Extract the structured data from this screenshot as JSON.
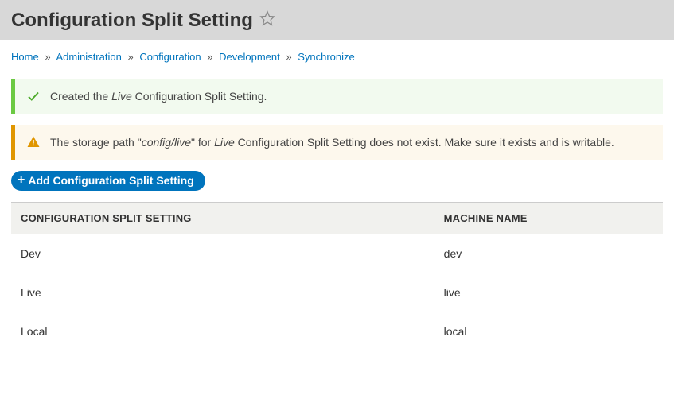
{
  "header": {
    "title": "Configuration Split Setting"
  },
  "breadcrumb": {
    "items": [
      {
        "label": "Home"
      },
      {
        "label": "Administration"
      },
      {
        "label": "Configuration"
      },
      {
        "label": "Development"
      },
      {
        "label": "Synchronize"
      }
    ],
    "separator": "»"
  },
  "messages": {
    "success": {
      "prefix": "Created the ",
      "em": "Live",
      "suffix": " Configuration Split Setting."
    },
    "warning": {
      "prefix": "The storage path \"",
      "path_em": "config/live",
      "mid": "\" for ",
      "name_em": "Live",
      "suffix": " Configuration Split Setting does not exist. Make sure it exists and is writable."
    }
  },
  "actions": {
    "add_label": "Add Configuration Split Setting"
  },
  "table": {
    "headers": {
      "name": "Configuration Split Setting",
      "machine": "Machine Name"
    },
    "rows": [
      {
        "name": "Dev",
        "machine": "dev"
      },
      {
        "name": "Live",
        "machine": "live"
      },
      {
        "name": "Local",
        "machine": "local"
      }
    ]
  }
}
